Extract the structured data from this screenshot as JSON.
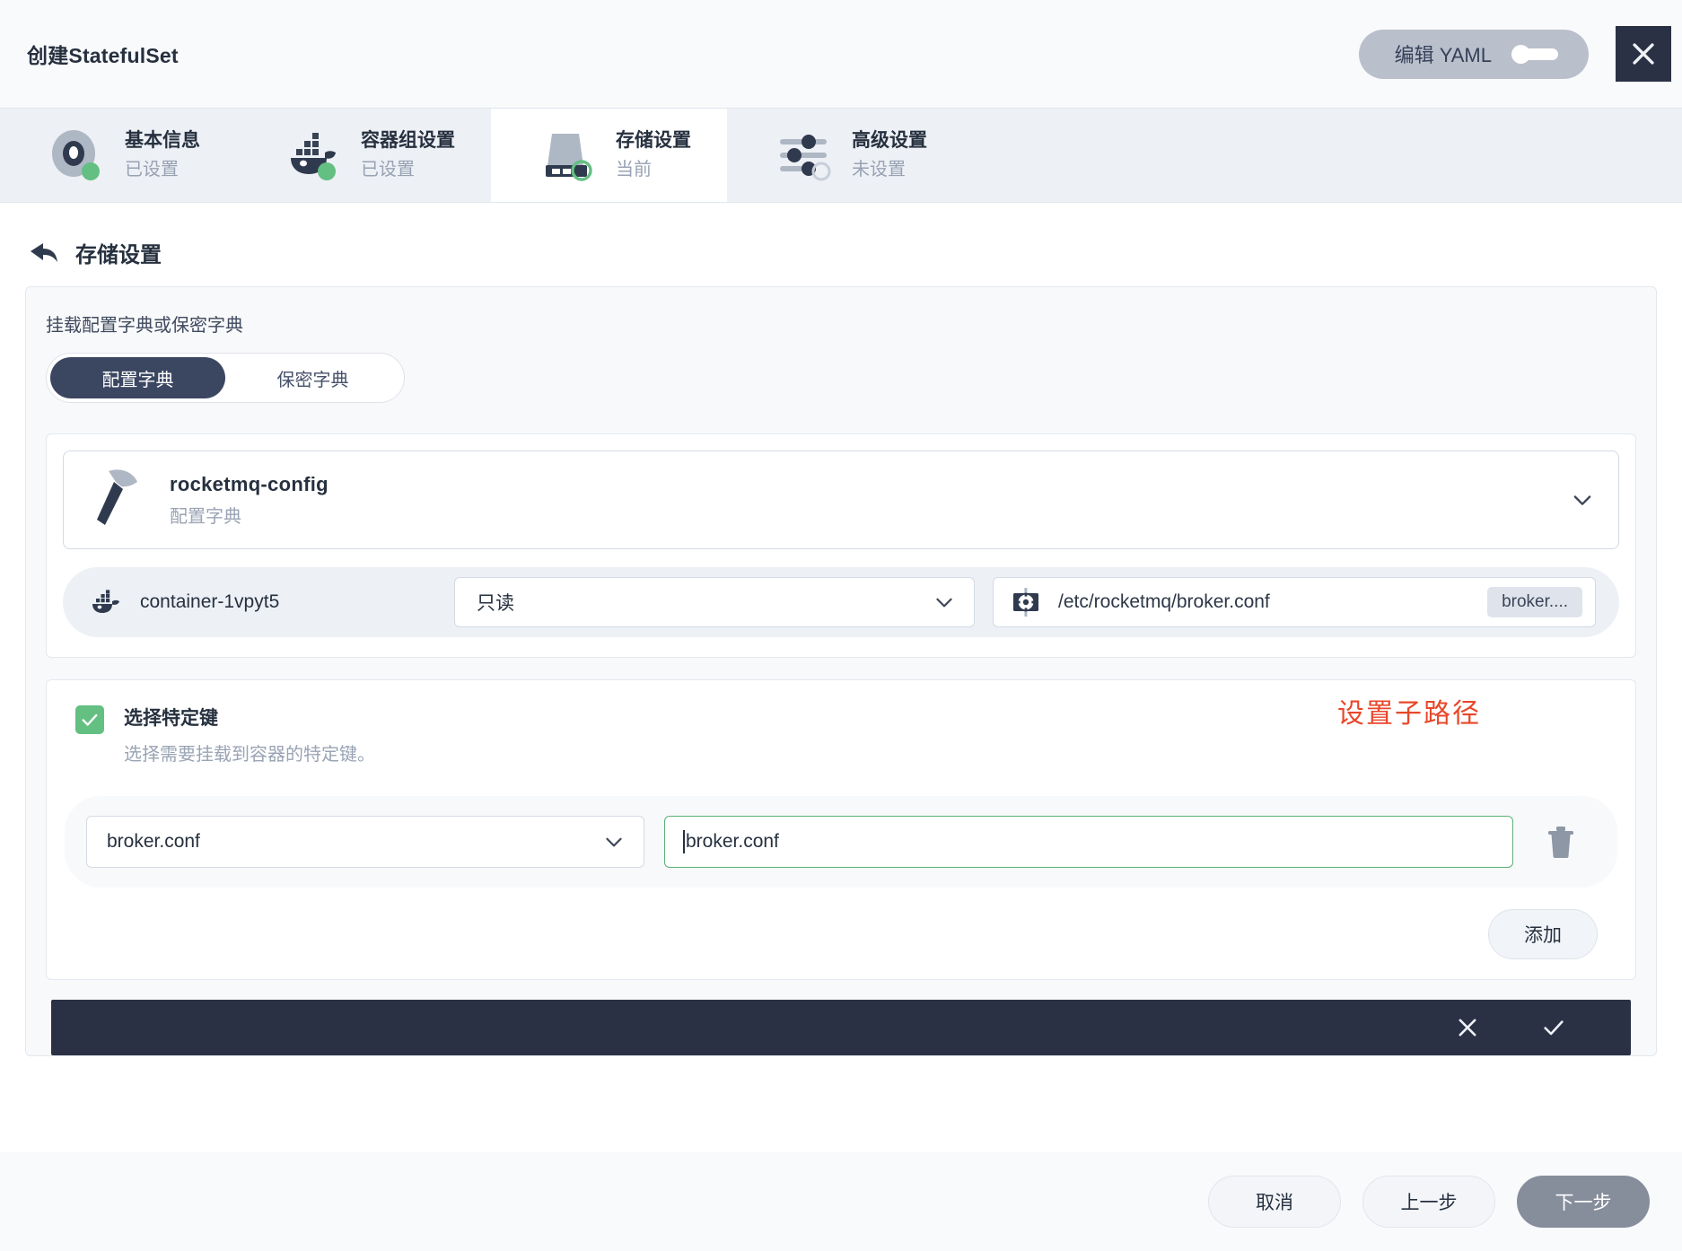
{
  "header": {
    "title": "创建StatefulSet",
    "yaml_toggle_label": "编辑 YAML",
    "close_icon": "close-icon"
  },
  "steps": [
    {
      "label": "基本信息",
      "status": "已设置",
      "icon": "target-icon",
      "active": false
    },
    {
      "label": "容器组设置",
      "status": "已设置",
      "icon": "docker-icon",
      "active": false
    },
    {
      "label": "存储设置",
      "status": "当前",
      "icon": "storage-icon",
      "active": true
    },
    {
      "label": "高级设置",
      "status": "未设置",
      "icon": "sliders-icon",
      "active": false
    }
  ],
  "section": {
    "title": "存储设置",
    "back_icon": "back-arrow-icon"
  },
  "panel": {
    "label": "挂载配置字典或保密字典",
    "segments": [
      {
        "label": "配置字典",
        "active": true
      },
      {
        "label": "保密字典",
        "active": false
      }
    ]
  },
  "configmap": {
    "name": "rocketmq-config",
    "kind": "配置字典",
    "icon": "hammer-icon",
    "expand_icon": "chevron-down-icon"
  },
  "mount": {
    "container_name": "container-1vpyt5",
    "container_icon": "docker-icon",
    "mode": "只读",
    "mode_icon": "chevron-down-icon",
    "path_icon": "gear-icon",
    "path": "/etc/rocketmq/broker.conf",
    "path_badge": "broker...."
  },
  "keys": {
    "checkbox_checked": true,
    "checkbox_icon": "check-icon",
    "title": "选择特定键",
    "description": "选择需要挂载到容器的特定键。",
    "annotation": "设置子路径",
    "rows": [
      {
        "key": "broker.conf",
        "key_icon": "chevron-down-icon",
        "subpath_value": "broker.conf",
        "subpath_placeholder": "子路径",
        "delete_icon": "trash-icon"
      }
    ],
    "add_label": "添加"
  },
  "confirm_bar": {
    "cancel_icon": "close-icon",
    "confirm_icon": "check-icon"
  },
  "footer": {
    "cancel": "取消",
    "previous": "上一步",
    "next": "下一步"
  },
  "colors": {
    "accent_dark": "#2a3145",
    "checkbox_green": "#64bf82",
    "annotation_red": "#e8472a",
    "input_focus_green": "#5cb176"
  }
}
